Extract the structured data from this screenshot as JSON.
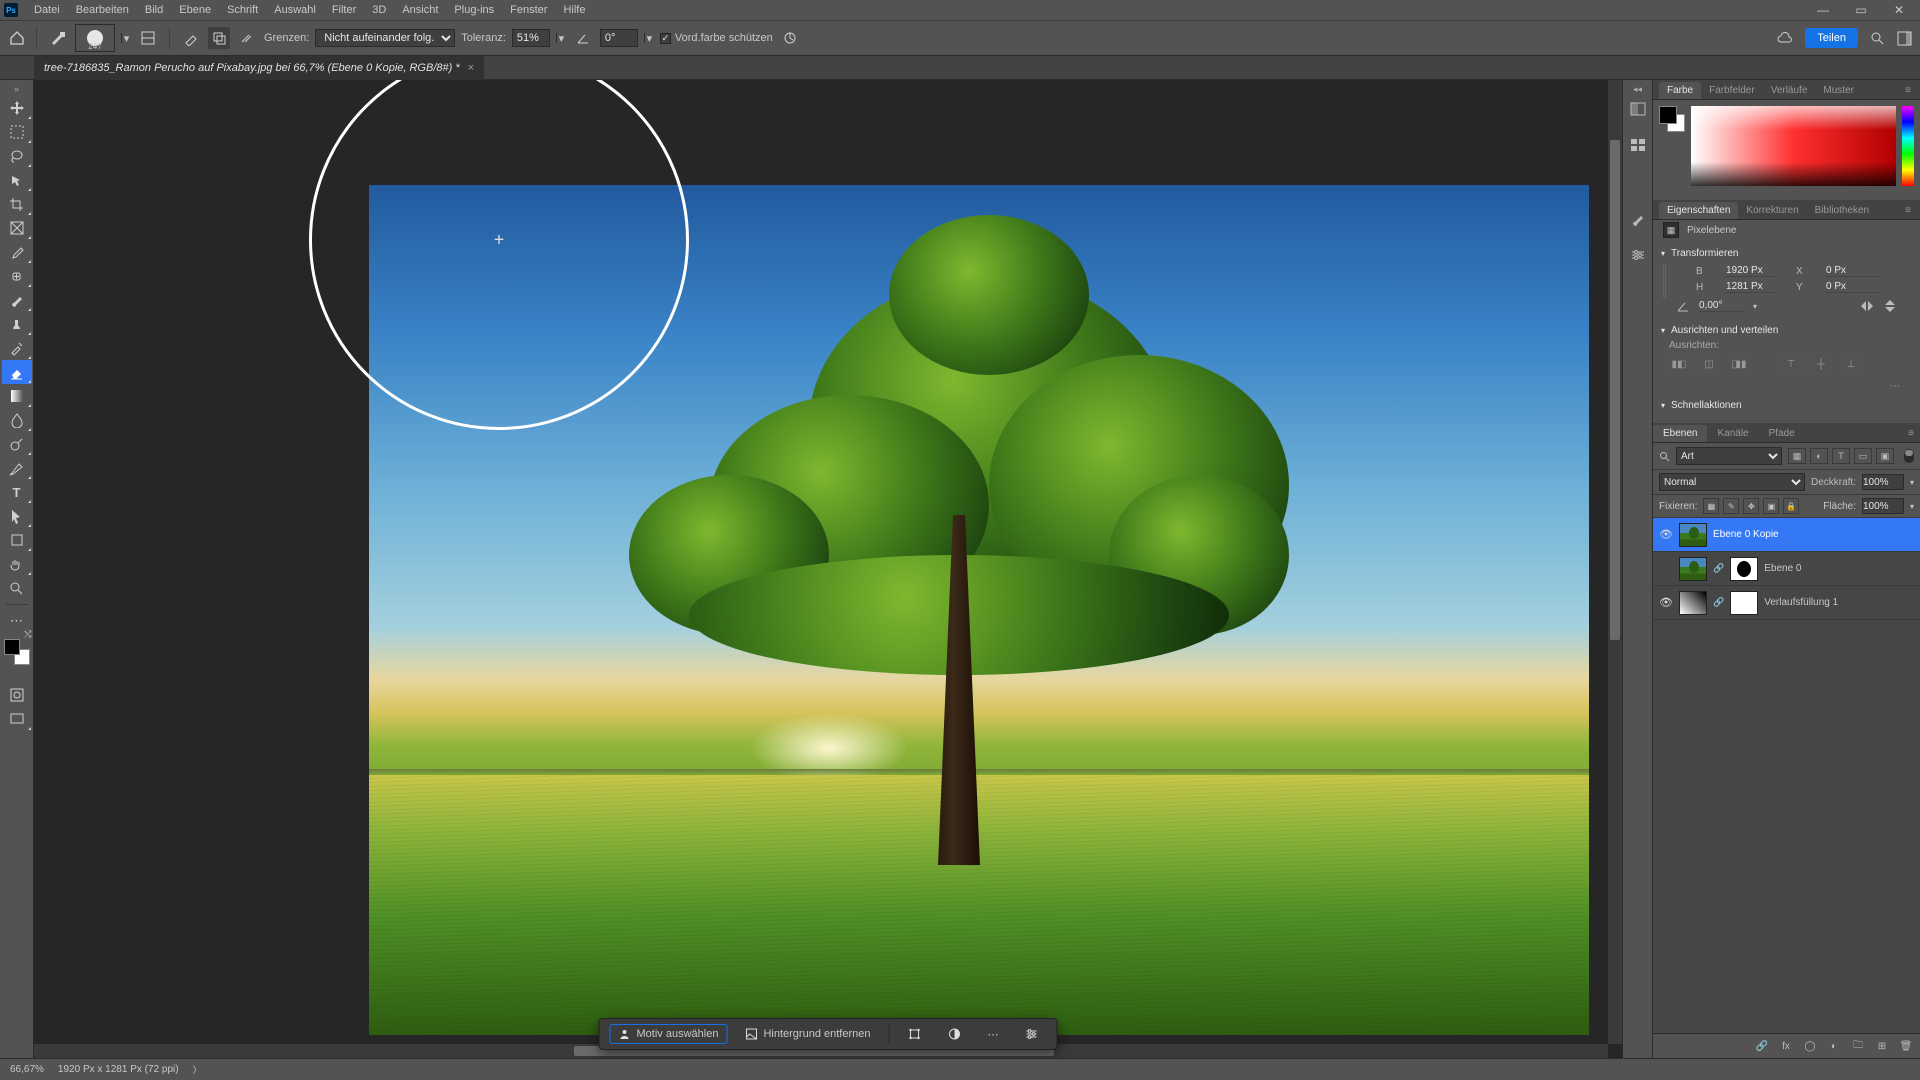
{
  "menubar": {
    "items": [
      "Datei",
      "Bearbeiten",
      "Bild",
      "Ebene",
      "Schrift",
      "Auswahl",
      "Filter",
      "3D",
      "Ansicht",
      "Plug-ins",
      "Fenster",
      "Hilfe"
    ]
  },
  "window_buttons": {
    "min": "—",
    "max": "▭",
    "close": "✕"
  },
  "optionsbar": {
    "brush_size": "247",
    "limits_label": "Grenzen:",
    "limits_value": "Nicht aufeinander folg.",
    "tolerance_label": "Toleranz:",
    "tolerance_value": "51%",
    "angle_icon_label": "0°",
    "protect_fg": "Vord.farbe schützen",
    "share": "Teilen"
  },
  "tab": {
    "title": "tree-7186835_Ramon Perucho auf Pixabay.jpg bei 66,7% (Ebene 0 Kopie, RGB/8#) *"
  },
  "tools": [
    "move",
    "marquee",
    "lasso",
    "wand",
    "crop",
    "frame",
    "eyedropper",
    "heal",
    "brush",
    "stamp",
    "history",
    "eraser",
    "gradient",
    "blur",
    "dodge",
    "pen",
    "type",
    "path",
    "shape",
    "hand",
    "zoom"
  ],
  "tool_active_index": 11,
  "ctx": {
    "select_subject": "Motiv auswählen",
    "remove_bg": "Hintergrund entfernen"
  },
  "panels": {
    "color_tabs": [
      "Farbe",
      "Farbfelder",
      "Verläufe",
      "Muster"
    ],
    "props_tabs": [
      "Eigenschaften",
      "Korrekturen",
      "Bibliotheken"
    ],
    "props_type": "Pixelebene",
    "transform_head": "Transformieren",
    "align_head": "Ausrichten und verteilen",
    "align_label": "Ausrichten:",
    "quick_head": "Schnellaktionen",
    "w_label": "B",
    "w_val": "1920 Px",
    "x_label": "X",
    "x_val": "0 Px",
    "h_label": "H",
    "h_val": "1281 Px",
    "y_label": "Y",
    "y_val": "0 Px",
    "angle": "0,00°",
    "layers_tabs": [
      "Ebenen",
      "Kanäle",
      "Pfade"
    ],
    "filter_kind": "Art",
    "blend_mode": "Normal",
    "opacity_label": "Deckkraft:",
    "opacity_val": "100%",
    "lock_label": "Fixieren:",
    "fill_label": "Fläche:",
    "fill_val": "100%",
    "layers": [
      {
        "name": "Ebene 0 Kopie",
        "visible": true,
        "selected": true,
        "mask": false
      },
      {
        "name": "Ebene 0",
        "visible": false,
        "selected": false,
        "mask": true,
        "maskblack": true
      },
      {
        "name": "Verlaufsfüllung 1",
        "visible": true,
        "selected": false,
        "mask": true,
        "grad": true
      }
    ]
  },
  "status": {
    "zoom": "66,67%",
    "dims": "1920 Px x 1281 Px (72 ppi)"
  }
}
